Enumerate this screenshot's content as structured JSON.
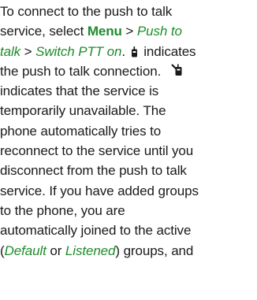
{
  "paragraph": {
    "line1": "To connect to the push to talk",
    "line2_start": "service, select ",
    "menu_label": "Menu",
    "sep": " > ",
    "push_to": "Push to",
    "talk": "talk",
    "switch_ptt": "Switch PTT on",
    "line3_end": ".",
    "indicates_conn": "indicates",
    "line4": "the push to talk connection.",
    "line5": "indicates that the service is",
    "line6": "temporarily unavailable. The",
    "line7": "phone automatically tries to",
    "line8": "reconnect to the service until you",
    "line9": "disconnect from the push to talk",
    "line10": "service. If you have added groups",
    "line11": "to the phone, you are",
    "line12": "automatically joined to the active",
    "line13_open": "(",
    "default_label": "Default",
    "or_word": " or ",
    "listened_label": "Listened",
    "line13_close": ") groups, and"
  },
  "icons": {
    "ptt_connected": "ptt-connected-icon",
    "ptt_unavailable": "ptt-unavailable-icon"
  },
  "colors": {
    "text": "#1a1a1a",
    "ui_term": "#1e8c2b"
  }
}
